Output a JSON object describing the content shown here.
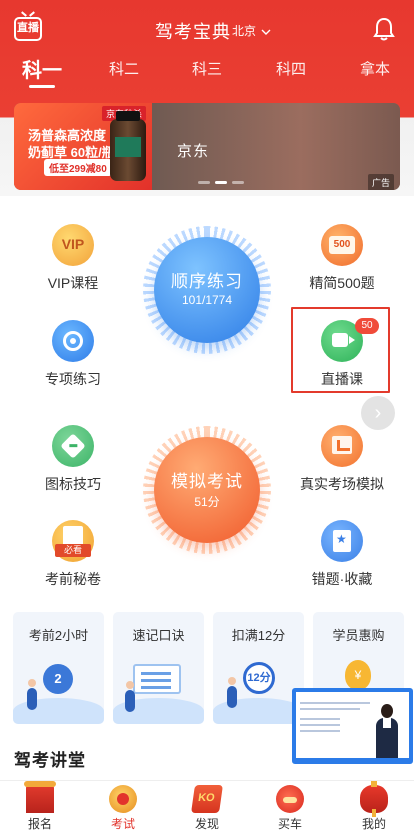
{
  "header": {
    "live_label": "直播",
    "app_title": "驾考宝典",
    "city": "北京",
    "tabs": [
      "科一",
      "科二",
      "科三",
      "科四",
      "拿本"
    ],
    "active_tab": 0
  },
  "banner": {
    "promo_line1": "汤普森高浓度",
    "promo_line2": "奶蓟草 60粒/瓶",
    "promo_tag": "低至299减80",
    "brand_mini": "京东秒杀",
    "title": "京东",
    "ad_label": "广告",
    "colors": {
      "left": "#e2312a",
      "right": "#8a6a5e"
    }
  },
  "features": {
    "vip": "VIP课程",
    "vip_icon_text": "VIP",
    "jingjian": "精简500题",
    "jingjian_icon_text": "500",
    "special": "专项练习",
    "live_course": "直播课",
    "sign_tips": "图标技巧",
    "real_exam": "真实考场模拟",
    "secret": "考前秘卷",
    "secret_icon_text": "必看",
    "wrong": "错题·收藏",
    "wrong_badge": "50"
  },
  "circles": {
    "sequential_title": "顺序练习",
    "sequential_progress": "101/1774",
    "mock_title": "模拟考试",
    "mock_score": "51分",
    "colors": {
      "blue": "#2e7de6",
      "orange": "#f05a2b"
    }
  },
  "cards": [
    {
      "title": "考前2小时",
      "icon_text": "2"
    },
    {
      "title": "速记口诀",
      "icon_text": ""
    },
    {
      "title": "扣满12分",
      "icon_text": "12分"
    },
    {
      "title": "学员惠购",
      "icon_text": "¥"
    }
  ],
  "section": {
    "title": "驾考讲堂"
  },
  "bottom_nav": [
    {
      "label": "报名",
      "icon": "registration-icon"
    },
    {
      "label": "考试",
      "icon": "exam-icon"
    },
    {
      "label": "发现",
      "icon": "discover-icon"
    },
    {
      "label": "买车",
      "icon": "buy-car-icon"
    },
    {
      "label": "我的",
      "icon": "profile-icon"
    }
  ],
  "active_nav": 1,
  "accent_color": "#e2342c"
}
